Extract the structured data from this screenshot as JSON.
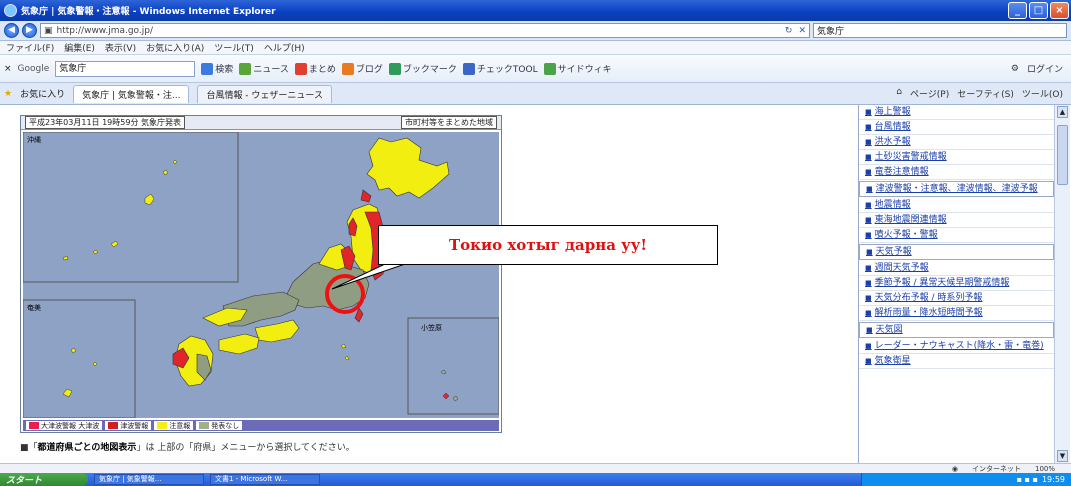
{
  "window": {
    "title": "気象庁 | 気象警報・注意報 - Windows Internet Explorer",
    "buttons": [
      "_",
      "□",
      "×"
    ]
  },
  "addressbar": {
    "url": "http://www.jma.go.jp/",
    "search_text": "気象庁",
    "go_icons": [
      "refresh-icon",
      "stop-icon"
    ]
  },
  "menu": [
    "ファイル(F)",
    "編集(E)",
    "表示(V)",
    "お気に入り(A)",
    "ツール(T)",
    "ヘルプ(H)"
  ],
  "google_toolbar": {
    "label": "Google",
    "query": "気象庁",
    "buttons": [
      "検索",
      "ニュース",
      "まとめ",
      "ブログ",
      "ブックマーク",
      "チェックTOOL",
      "サイドウィキ"
    ],
    "right": [
      "ログイン"
    ]
  },
  "tabs": {
    "favorites_label": "お気に入り",
    "items": [
      "気象庁 | 気象警報・注...",
      "台風情報 - ウェザーニュース"
    ],
    "commands": [
      "ページ(P)",
      "セーフティ(S)",
      "ツール(O)"
    ]
  },
  "map": {
    "date": "平成23年03月11日 19時59分 気象庁発表",
    "mode": "市町村等をまとめた地域",
    "inset_labels": [
      "沖縄",
      "奄美",
      "小笠原"
    ],
    "legend": [
      {
        "label": "大津波警報 大津波",
        "color": "#e8204a"
      },
      {
        "label": "津波警報",
        "color": "#cc2222"
      },
      {
        "label": "注意報",
        "color": "#f4f014"
      },
      {
        "label": "発表なし",
        "color": "#9fb08a"
      }
    ],
    "colors": {
      "sea": "#8ea2c6",
      "land_gray": "#8f9e82",
      "warning_red": "#e0262a",
      "advisory_yellow": "#f2ee10",
      "highlight_circle": "#ee1111"
    }
  },
  "note": {
    "bold": "都道府県ごとの地図表示",
    "rest": "は 上部の「府県」メニューから選択してください。"
  },
  "callout": {
    "text": "Токио хотыг дарна уу!"
  },
  "sidebar": {
    "items": [
      "海上警報",
      "台風情報",
      "洪水予報",
      "土砂災害警戒情報",
      "竜巻注意情報",
      "津波警報・注意報、津波情報、津波予報",
      "地震情報",
      "東海地震関連情報",
      "噴火予報・警報",
      "天気予報",
      "週間天気予報",
      "季節予報 / 異常天候早期警戒情報",
      "天気分布予報 / 時系列予報",
      "解析雨量・降水短時間予報",
      "天気図",
      "レーダー・ナウキャスト(降水・雷・竜巻)",
      "気象衛星"
    ]
  },
  "statusbar": {
    "zone": "インターネット",
    "zoom": "100%"
  },
  "taskbar": {
    "start": "スタート",
    "tasks": [
      "気象庁 | 気象警報...",
      "文書1 - Microsoft W..."
    ],
    "clock": "19:59"
  }
}
